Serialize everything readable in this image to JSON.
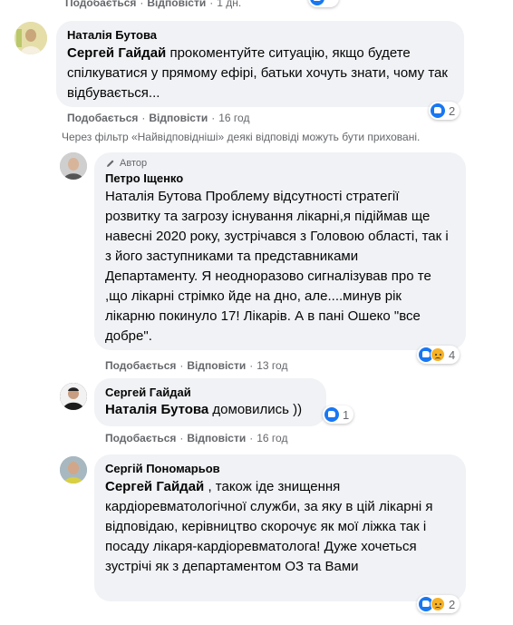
{
  "actions": {
    "like": "Подобається",
    "reply": "Відповісти",
    "separator": "·"
  },
  "top_row": {
    "time": "1 дн.",
    "reactions_count": ""
  },
  "comments": [
    {
      "author": "Наталія Бутова",
      "mention": "Сергей Гайдай",
      "text": " прокоментуйте ситуацію, якщо будете спілкуватися у прямому ефірі, батьки хочуть знати, чому так відбувається...",
      "time": "16 год",
      "reactions_count": "2"
    }
  ],
  "filter_notice": "Через фільтр «Найвідповідніші» деякі відповіді можуть бути приховані.",
  "replies": [
    {
      "badge": "Автор",
      "author": "Петро Іщенко",
      "mention": "",
      "text": "Наталія Бутова Проблему відсутності стратегії розвитку та загрозу існування лікарні,я підіймав ще навесні 2020 року, зустрічався з Головою області, так і з його заступниками та представниками Департаменту. Я неодноразово сигналізував про те ,що лікарні стрімко йде на дно, але....минув рік лікарню покинуло 17! Лікарів. А в пані Ошеко \"все добре\".",
      "time": "13 год",
      "reactions_count": "4"
    },
    {
      "author": "Сергей Гайдай",
      "mention": "Наталія Бутова",
      "text": " домовились ))",
      "time": "16 год",
      "reactions_count": "1"
    },
    {
      "author": "Сергій Пономарьов",
      "mention": "Сергей Гайдай",
      "text": " , також іде знищення кардіоревматологічної служби, за яку в цій лікарні я відповідаю, керівництво скорочує як мої ліжка так і посаду лікаря-кардіоревматолога! Дуже хочеться зустрічі як з департаментом ОЗ та Вами",
      "time": "",
      "reactions_count": "2"
    }
  ]
}
